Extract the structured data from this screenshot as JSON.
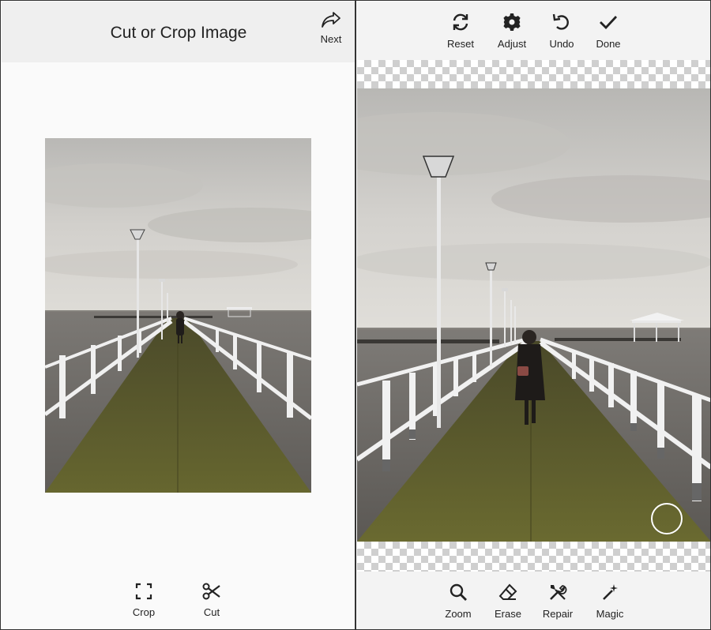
{
  "left_panel": {
    "title": "Cut or Crop Image",
    "next_label": "Next",
    "tools": [
      {
        "label": "Crop",
        "icon": "crop-frame-icon"
      },
      {
        "label": "Cut",
        "icon": "scissors-icon"
      }
    ]
  },
  "right_panel": {
    "top_tools": [
      {
        "label": "Reset",
        "icon": "reset-arrows-icon"
      },
      {
        "label": "Adjust",
        "icon": "gear-icon"
      },
      {
        "label": "Undo",
        "icon": "undo-icon"
      },
      {
        "label": "Done",
        "icon": "checkmark-icon"
      }
    ],
    "bottom_tools": [
      {
        "label": "Zoom",
        "icon": "magnifier-icon"
      },
      {
        "label": "Erase",
        "icon": "eraser-icon"
      },
      {
        "label": "Repair",
        "icon": "wrench-screwdriver-icon"
      },
      {
        "label": "Magic",
        "icon": "magic-wand-icon"
      }
    ]
  },
  "colors": {
    "header_bg": "#efefef",
    "toolbar_bg": "#f3f3f3",
    "sky": "#cfcdc8",
    "water": "#6f6b67",
    "deck": "#5a5a2c",
    "rail": "#f2f2f2"
  }
}
